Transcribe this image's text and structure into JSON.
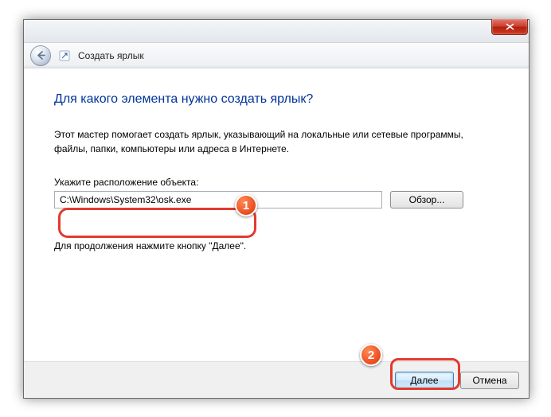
{
  "window": {
    "nav_title": "Создать ярлык"
  },
  "content": {
    "heading": "Для какого элемента нужно создать ярлык?",
    "description": "Этот мастер помогает создать ярлык, указывающий на локальные или сетевые программы, файлы, папки, компьютеры или адреса в Интернете.",
    "field_label": "Укажите расположение объекта:",
    "path_value": "C:\\Windows\\System32\\osk.exe",
    "browse_label": "Обзор...",
    "continue_hint": "Для продолжения нажмите кнопку \"Далее\"."
  },
  "footer": {
    "next_label": "Далее",
    "cancel_label": "Отмена"
  },
  "annotations": {
    "badge1": "1",
    "badge2": "2"
  }
}
